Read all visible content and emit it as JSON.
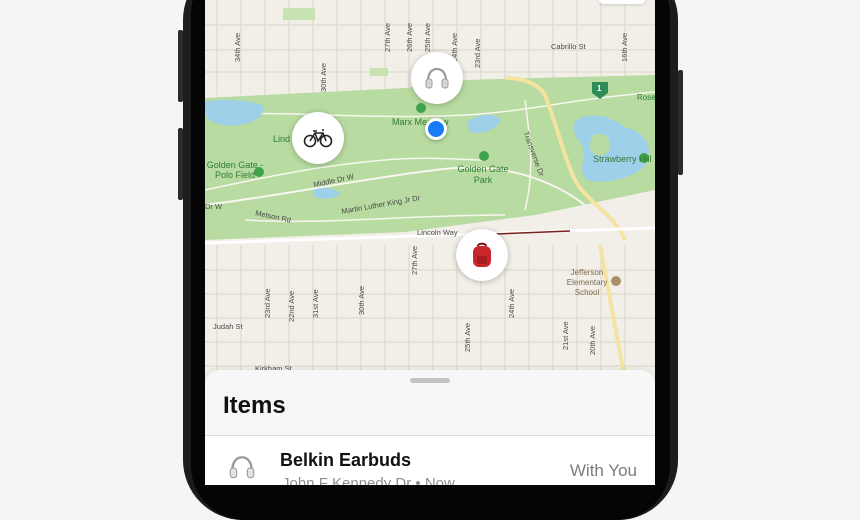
{
  "map": {
    "streets": {
      "avenue_34": "34th Ave",
      "avenue_30": "30th Ave",
      "avenue_27": "27th Ave",
      "avenue_26": "26th Ave",
      "avenue_25": "25th Ave",
      "avenue_24": "24th Ave",
      "avenue_23": "23rd Ave",
      "avenue_16": "16th Ave",
      "cabrillo": "Cabrillo St",
      "middle_dr": "Middle Dr W",
      "mlk": "Martin Luther King Jr Dr",
      "metson": "Metson Rd",
      "lincoln": "Lincoln Way",
      "judah": "Judah St",
      "kirkham": "Kirkham St",
      "transverse": "Transverse Dr",
      "dr_w": "Dr W",
      "ave_27_s": "27th Ave",
      "ave_23_s": "23rd Ave",
      "ave_22_s": "22nd Ave",
      "ave_31_s": "31st Ave",
      "ave_30_s": "30th Ave",
      "ave_25_s": "25th Ave",
      "ave_24_s": "24th Ave",
      "ave_21_s": "21st Ave",
      "ave_20_s": "20th Ave"
    },
    "places": {
      "marx_meadow": "Marx Meadow",
      "lindley": "Lind",
      "golden_gate_polo": "Golden Gate - Polo Field",
      "golden_gate_park": "Golden Gate Park",
      "strawberry_hill": "Strawberry Hill",
      "jefferson_school": "Jefferson Elementary School",
      "rose": "Rose",
      "route_shield": "1"
    },
    "pins": [
      "headphones-icon",
      "bicycle-icon",
      "backpack-icon"
    ]
  },
  "sheet": {
    "title": "Items",
    "items": [
      {
        "name": "Belkin Earbuds",
        "location": "John F Kennedy Dr • Now",
        "status": "With You",
        "icon": "headphones-icon"
      }
    ]
  },
  "colors": {
    "park": "#b7dba0",
    "water": "#9fd0ea",
    "land": "#f2efe9",
    "user_location": "#1a7cf5",
    "street_line": "#e0d9cd",
    "highway": "#f4e3a1"
  }
}
